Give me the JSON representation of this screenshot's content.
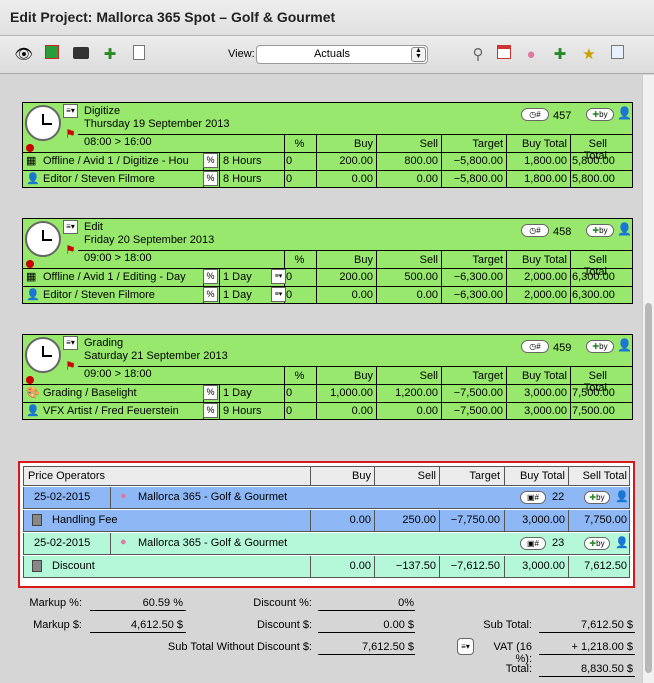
{
  "window": {
    "title": "Edit Project: Mallorca 365 Spot – Golf & Gourmet"
  },
  "toolbar": {
    "view_label": "View:",
    "view_value": "Actuals",
    "icons": [
      "eye-icon",
      "cubes-icon",
      "film-reel-icon",
      "add-user-icon",
      "new-doc-icon",
      "search-icon",
      "calendar-icon",
      "piggy-bank-icon",
      "cart-add-icon",
      "trophy-icon",
      "add-doc-icon"
    ]
  },
  "columns": {
    "pct": "%",
    "buy": "Buy",
    "sell": "Sell",
    "target": "Target",
    "buy_total": "Buy Total",
    "sell_total": "Sell Total"
  },
  "tasks": [
    {
      "name": "Digitize",
      "date": "Thursday 19 September 2013",
      "time": "08:00 > 16:00",
      "number": "457",
      "badge": "#",
      "by_label": "by",
      "rows": [
        {
          "resource": "Offline / Avid 1 / Digitize - Hou",
          "qty": "8 Hours",
          "pct": "0",
          "buy": "200.00",
          "sell": "800.00",
          "target": "−5,800.00",
          "buy_total": "1,800.00",
          "sell_total": "5,800.00",
          "icon": "film-icon"
        },
        {
          "resource": "Editor / Steven Filmore",
          "qty": "8 Hours",
          "pct": "0",
          "buy": "0.00",
          "sell": "0.00",
          "target": "−5,800.00",
          "buy_total": "1,800.00",
          "sell_total": "5,800.00",
          "icon": "person-icon"
        }
      ]
    },
    {
      "name": "Edit",
      "date": "Friday 20 September 2013",
      "time": "09:00 > 18:00",
      "number": "458",
      "badge": "#",
      "by_label": "by",
      "rows": [
        {
          "resource": "Offline / Avid 1 / Editing - Day",
          "qty": "1 Day",
          "pct": "0",
          "buy": "200.00",
          "sell": "500.00",
          "target": "−6,300.00",
          "buy_total": "2,000.00",
          "sell_total": "6,300.00",
          "icon": "film-icon"
        },
        {
          "resource": "Editor / Steven Filmore",
          "qty": "1 Day",
          "pct": "0",
          "buy": "0.00",
          "sell": "0.00",
          "target": "−6,300.00",
          "buy_total": "2,000.00",
          "sell_total": "6,300.00",
          "icon": "person-icon"
        }
      ]
    },
    {
      "name": "Grading",
      "date": "Saturday 21 September 2013",
      "time": "09:00 > 18:00",
      "number": "459",
      "badge": "#",
      "by_label": "by",
      "rows": [
        {
          "resource": "Grading / Baselight",
          "qty": "1 Day",
          "pct": "0",
          "buy": "1,000.00",
          "sell": "1,200.00",
          "target": "−7,500.00",
          "buy_total": "3,000.00",
          "sell_total": "7,500.00",
          "icon": "palette-icon"
        },
        {
          "resource": "VFX Artist / Fred Feuerstein",
          "qty": "9 Hours",
          "pct": "0",
          "buy": "0.00",
          "sell": "0.00",
          "target": "−7,500.00",
          "buy_total": "3,000.00",
          "sell_total": "7,500.00",
          "icon": "person-icon"
        }
      ]
    }
  ],
  "price_operators": {
    "header": "Price Operators",
    "buy": "Buy",
    "sell": "Sell",
    "target": "Target",
    "buy_total": "Buy Total",
    "sell_total": "Sell Total",
    "items": [
      {
        "date": "25-02-2015",
        "project": "Mallorca 365 - Golf & Gourmet",
        "number": "22",
        "badge": "#",
        "by_label": "by",
        "label": "Handling Fee",
        "buy": "0.00",
        "sell": "250.00",
        "target": "−7,750.00",
        "buy_total": "3,000.00",
        "sell_total": "7,750.00"
      },
      {
        "date": "25-02-2015",
        "project": "Mallorca 365 - Golf & Gourmet",
        "number": "23",
        "badge": "#",
        "by_label": "by",
        "label": "Discount",
        "buy": "0.00",
        "sell": "−137.50",
        "target": "−7,612.50",
        "buy_total": "3,000.00",
        "sell_total": "7,612.50"
      }
    ]
  },
  "summary": {
    "markup_pct_label": "Markup %:",
    "markup_pct": "60.59 %",
    "markup_amt_label": "Markup $:",
    "markup_amt": "4,612.50 $",
    "discount_pct_label": "Discount %:",
    "discount_pct": "0%",
    "discount_amt_label": "Discount $:",
    "discount_amt": "0.00 $",
    "subtotal_wo_label": "Sub Total Without Discount $:",
    "subtotal_wo": "7,612.50 $",
    "subtotal_label": "Sub Total:",
    "subtotal": "7,612.50 $",
    "vat_label": "VAT (16 %):",
    "vat": "+ 1,218.00 $",
    "total_label": "Total:",
    "total": "8,830.50 $"
  }
}
